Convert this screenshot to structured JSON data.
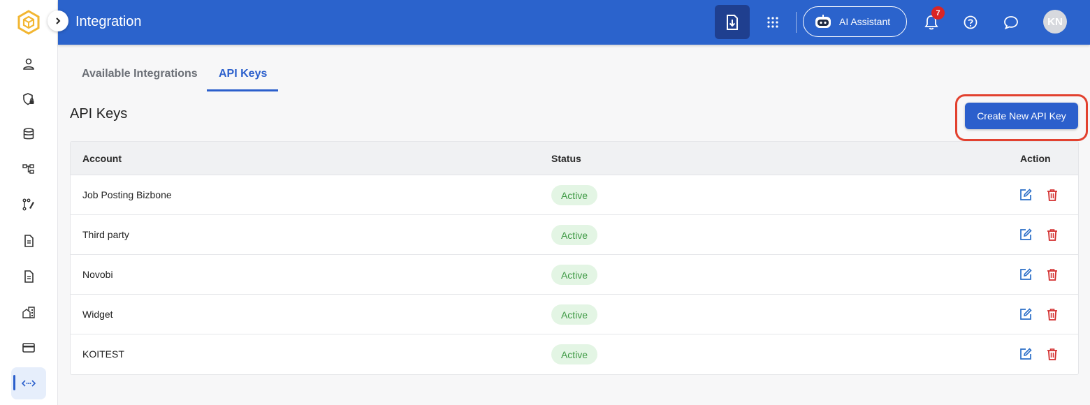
{
  "header": {
    "title": "Integration",
    "notification_count": "7",
    "ai_assistant_label": "AI Assistant",
    "avatar_initials": "KN"
  },
  "sidebar": {
    "items": [
      {
        "icon": "user-icon"
      },
      {
        "icon": "shield-lock-icon"
      },
      {
        "icon": "database-icon"
      },
      {
        "icon": "hierarchy-icon"
      },
      {
        "icon": "workflow-edit-icon"
      },
      {
        "icon": "document-icon"
      },
      {
        "icon": "document-icon"
      },
      {
        "icon": "buildings-icon"
      },
      {
        "icon": "credit-card-icon"
      },
      {
        "icon": "api-code-icon",
        "active": true
      }
    ]
  },
  "tabs": [
    {
      "label": "Available Integrations",
      "active": false
    },
    {
      "label": "API Keys",
      "active": true
    }
  ],
  "section": {
    "title": "API Keys",
    "create_button": "Create New API Key"
  },
  "table": {
    "columns": [
      "Account",
      "Status",
      "Action"
    ],
    "rows": [
      {
        "account": "Job Posting Bizbone",
        "status": "Active"
      },
      {
        "account": "Third party",
        "status": "Active"
      },
      {
        "account": "Novobi",
        "status": "Active"
      },
      {
        "account": "Widget",
        "status": "Active"
      },
      {
        "account": "KOITEST",
        "status": "Active"
      }
    ]
  },
  "colors": {
    "primary": "#2b63cc",
    "active_badge_bg": "#e3f5e4",
    "active_badge_text": "#3f9a45",
    "delete_red": "#d32f2f",
    "highlight_outline": "#e2412f"
  }
}
